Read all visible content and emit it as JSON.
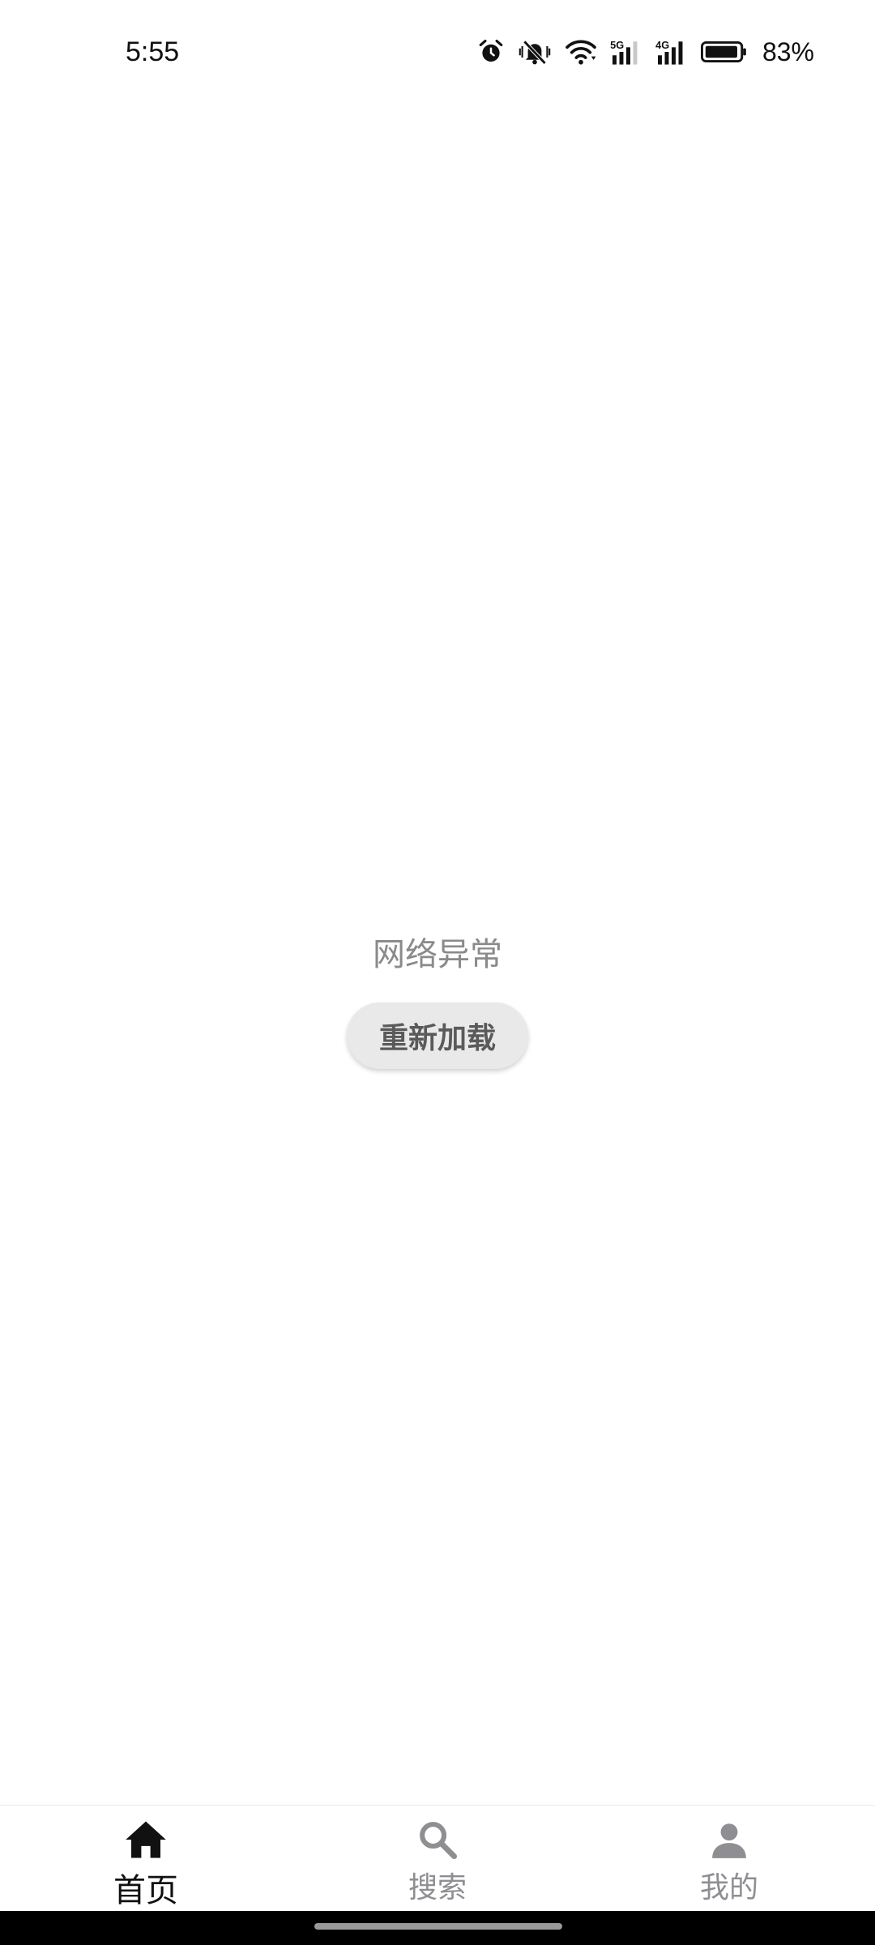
{
  "status_bar": {
    "time": "5:55",
    "battery_percent": "83%",
    "network_5g": "5G",
    "network_4g": "4G"
  },
  "main": {
    "error_message": "网络异常",
    "reload_label": "重新加载"
  },
  "bottom_nav": {
    "items": [
      {
        "label": "首页",
        "icon": "home-icon",
        "active": true
      },
      {
        "label": "搜索",
        "icon": "search-icon",
        "active": false
      },
      {
        "label": "我的",
        "icon": "person-icon",
        "active": false
      }
    ]
  },
  "colors": {
    "active": "#111111",
    "inactive": "#8e8e93",
    "button_bg": "#e9e9e9"
  }
}
